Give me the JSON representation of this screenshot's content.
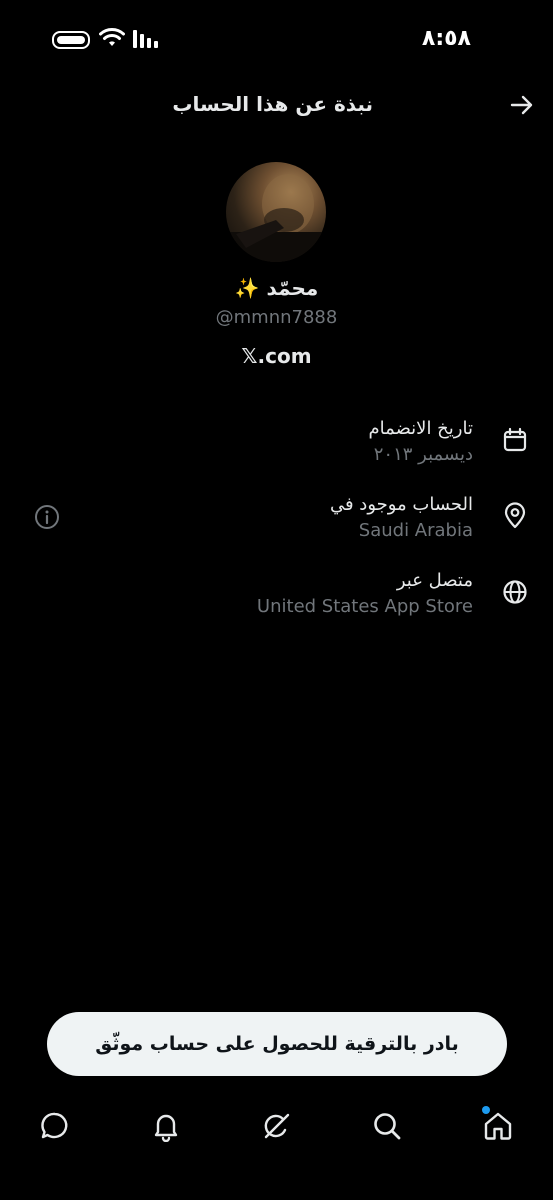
{
  "status_bar": {
    "time": "٨:٥٨"
  },
  "header": {
    "title": "نبذة عن هذا الحساب",
    "back_icon": "arrow-right-icon"
  },
  "profile": {
    "display_name": "محمّد ✨",
    "handle": "@mmnn7888",
    "site": "𝕏.com"
  },
  "info": {
    "joined_label": "تاريخ الانضمام",
    "joined_value": "ديسمبر ٢٠١٣",
    "location_label": "الحساب موجود في",
    "location_value": "Saudi Arabia",
    "connected_label": "متصل عبر",
    "connected_value": "United States App Store"
  },
  "upgrade": {
    "label": "بادر بالترقية للحصول على حساب موثّق"
  },
  "nav": {
    "items": [
      "home-icon",
      "search-icon",
      "grok-icon",
      "notifications-icon",
      "messages-icon"
    ],
    "accent": "#1d9bf0"
  }
}
